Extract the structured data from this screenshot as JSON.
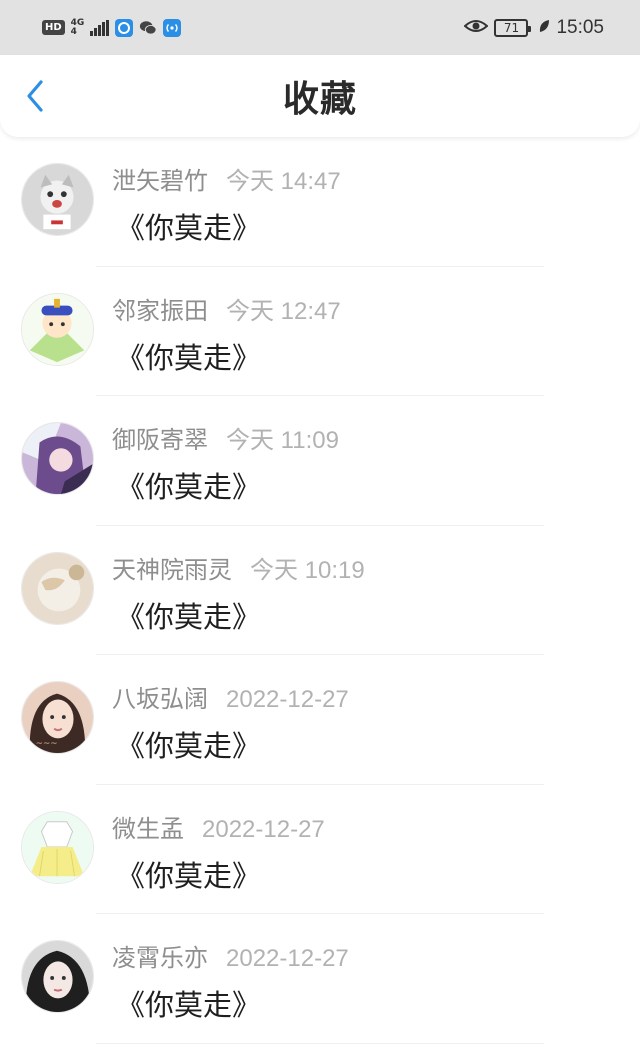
{
  "status_bar": {
    "hd": "HD",
    "network_top": "4G",
    "network_bottom": "4",
    "battery": "71",
    "time": "15:05"
  },
  "header": {
    "title": "收藏",
    "back_icon": "chevron-left-icon"
  },
  "colors": {
    "accent": "#2b8fe6",
    "status_bar_bg": "#e2e2e2",
    "name_text": "#8e8e8e",
    "timestamp_text": "#b2b2b2",
    "content_text": "#1f1f1f"
  },
  "favorites": [
    {
      "name": "泄矢碧竹",
      "time": "今天 14:47",
      "content": "《你莫走》"
    },
    {
      "name": "邻家振田",
      "time": "今天 12:47",
      "content": "《你莫走》"
    },
    {
      "name": "御阪寄翠",
      "time": "今天 11:09",
      "content": "《你莫走》"
    },
    {
      "name": "天神院雨灵",
      "time": "今天 10:19",
      "content": "《你莫走》"
    },
    {
      "name": "八坂弘阔",
      "time": "2022-12-27",
      "content": "《你莫走》"
    },
    {
      "name": "微生孟",
      "time": "2022-12-27",
      "content": "《你莫走》"
    },
    {
      "name": "凌霄乐亦",
      "time": "2022-12-27",
      "content": "《你莫走》"
    }
  ]
}
